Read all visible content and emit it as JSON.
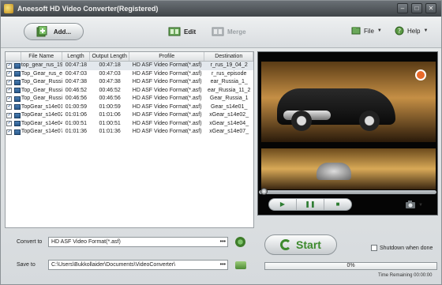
{
  "window": {
    "title": "Aneesoft HD Video Converter(Registered)",
    "controls": [
      "–",
      "□",
      "✕"
    ]
  },
  "toolbar": {
    "add_label": "Add...",
    "edit_label": "Edit",
    "merge_label": "Merge",
    "file_label": "File",
    "help_label": "Help"
  },
  "list": {
    "columns": [
      "File Name",
      "Length",
      "Output Length",
      "Profile",
      "Destination"
    ],
    "rows": [
      {
        "name": "top_gear_rus_19",
        "length": "00:47:18",
        "output": "00:47:18",
        "profile": "HD ASF Video Format(*.asf)",
        "dest": "r_rus_19_04_2"
      },
      {
        "name": "Top_Gear_rus_e",
        "length": "00:47:03",
        "output": "00:47:03",
        "profile": "HD ASF Video Format(*.asf)",
        "dest": "r_rus_episode"
      },
      {
        "name": "Top_Gear_Russi",
        "length": "00:47:38",
        "output": "00:47:38",
        "profile": "HD ASF Video Format(*.asf)",
        "dest": "ear_Russia_1_"
      },
      {
        "name": "Top_Gear_Russi",
        "length": "00:46:52",
        "output": "00:46:52",
        "profile": "HD ASF Video Format(*.asf)",
        "dest": "ear_Russia_11_2"
      },
      {
        "name": "Top_Gear_Russi",
        "length": "00:46:56",
        "output": "00:46:56",
        "profile": "HD ASF Video Format(*.asf)",
        "dest": "Gear_Russia_1"
      },
      {
        "name": "TopGear_s14e01",
        "length": "01:00:59",
        "output": "01:00:59",
        "profile": "HD ASF Video Format(*.asf)",
        "dest": "Gear_s14e01_"
      },
      {
        "name": "TopGear_s14e02",
        "length": "01:01:06",
        "output": "01:01:06",
        "profile": "HD ASF Video Format(*.asf)",
        "dest": "xGear_s14e02_"
      },
      {
        "name": "TopGear_s14e04",
        "length": "01:00:51",
        "output": "01:00:51",
        "profile": "HD ASF Video Format(*.asf)",
        "dest": "xGear_s14e04_"
      },
      {
        "name": "TopGear_s14e07",
        "length": "01:01:36",
        "output": "01:01:36",
        "profile": "HD ASF Video Format(*.asf)",
        "dest": "xGear_s14e07_"
      }
    ]
  },
  "player": {
    "play": "▶",
    "pause": "❚❚",
    "stop": "■",
    "snapshot_icon": "camera-icon",
    "seek_fraction": 0.0
  },
  "convert": {
    "convert_label": "Convert to",
    "convert_value": "HD ASF Video Format(*.asf)",
    "save_label": "Save to",
    "save_value": "C:\\Users\\Bukkollaider\\Documents\\VideoConverter\\",
    "dots": "•••"
  },
  "start": {
    "label": "Start",
    "shutdown_label": "Shutdown when done",
    "progress_text": "0%",
    "progress_fraction": 0,
    "time_remaining": "Time Remaining 00:00:00"
  },
  "colors": {
    "accent_green": "#3d8a2d",
    "title_bar": "#4a4f53"
  }
}
